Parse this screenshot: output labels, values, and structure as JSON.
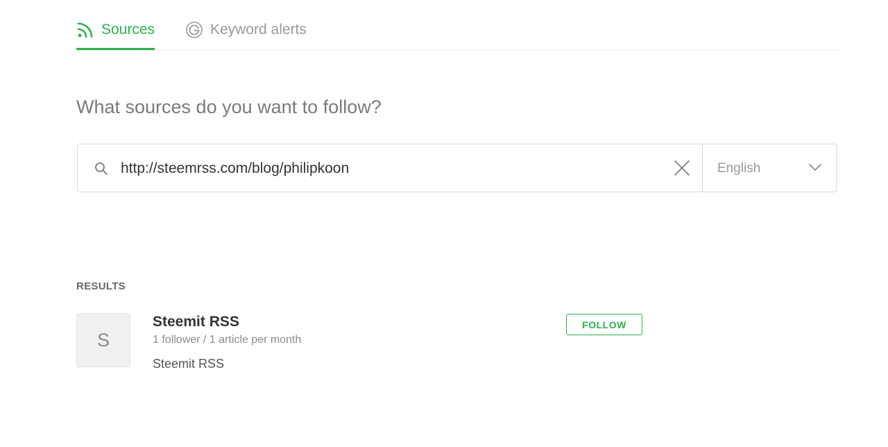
{
  "tabs": [
    {
      "label": "Sources",
      "icon": "rss-icon",
      "active": true
    },
    {
      "label": "Keyword alerts",
      "icon": "google-icon",
      "active": false
    }
  ],
  "heading": "What sources do you want to follow?",
  "search": {
    "value": "http://steemrss.com/blog/philipkoon",
    "language": "English"
  },
  "results": {
    "label": "RESULTS",
    "items": [
      {
        "avatar_letter": "S",
        "title": "Steemit RSS",
        "meta": "1 follower / 1 article per month",
        "description": "Steemit RSS",
        "button": "FOLLOW"
      }
    ]
  },
  "colors": {
    "accent": "#2bb24c",
    "muted_text": "#999999",
    "border": "#d6d6d6"
  }
}
